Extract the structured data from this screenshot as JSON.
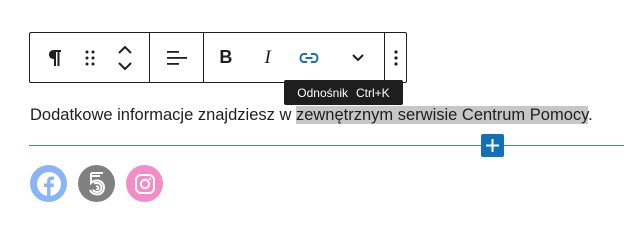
{
  "toolbar": {
    "paragraph_icon": "pilcrow-icon",
    "drag_icon": "drag-handle-icon",
    "move_icon": "chevron-up-down-icon",
    "align_icon": "align-left-icon",
    "bold_label": "B",
    "italic_label": "I",
    "link_icon": "link-icon",
    "more_icon": "chevron-down-icon",
    "options_icon": "vertical-ellipsis-icon"
  },
  "tooltip": {
    "label": "Odnośnik",
    "shortcut": "Ctrl+K"
  },
  "paragraph": {
    "text_before": "Dodatkowe informacje znajdziesz w ",
    "selected_text": "zewnętrznym serwisie Centrum Pomocy",
    "text_after": "."
  },
  "inserter": {
    "icon": "plus-icon"
  },
  "social_icons": [
    {
      "name": "facebook-icon",
      "color": "#8ab4f8"
    },
    {
      "name": "fivehundredpx-icon",
      "color": "#808080"
    },
    {
      "name": "instagram-icon",
      "color": "#f48cc8"
    }
  ],
  "colors": {
    "accent": "#1271b5",
    "link_icon": "#1271b5",
    "selection": "#c7c7c7",
    "tooltip_bg": "#1e1e1e"
  }
}
